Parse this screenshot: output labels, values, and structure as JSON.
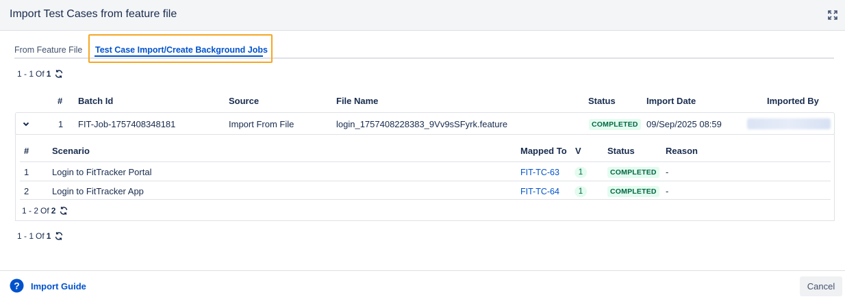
{
  "dialog": {
    "title": "Import Test Cases from feature file"
  },
  "tabs": [
    {
      "label": "From Feature File",
      "active": false
    },
    {
      "label": "Test Case Import/Create Background Jobs",
      "active": true
    }
  ],
  "top_pager": {
    "range": "1 - 1",
    "of_label": "Of",
    "total": "1"
  },
  "jobs_table": {
    "columns": [
      "#",
      "Batch Id",
      "Source",
      "File Name",
      "Status",
      "Import Date",
      "Imported By"
    ],
    "rows": [
      {
        "num": "1",
        "batch_id": "FIT-Job-1757408348181",
        "source": "Import From File",
        "file_name": "login_1757408228383_9Vv9sSFyrk.feature",
        "status": "COMPLETED",
        "import_date": "09/Sep/2025 08:59",
        "imported_by": ""
      }
    ]
  },
  "scenarios_table": {
    "columns": [
      "#",
      "Scenario",
      "Mapped To",
      "V",
      "Status",
      "Reason"
    ],
    "rows": [
      {
        "num": "1",
        "scenario": "Login to FitTracker Portal",
        "mapped_to": "FIT-TC-63",
        "version": "1",
        "status": "COMPLETED",
        "reason": "-"
      },
      {
        "num": "2",
        "scenario": "Login to FitTracker App",
        "mapped_to": "FIT-TC-64",
        "version": "1",
        "status": "COMPLETED",
        "reason": "-"
      }
    ],
    "pager": {
      "range": "1 - 2",
      "of_label": "Of",
      "total": "2"
    }
  },
  "bottom_pager": {
    "range": "1 - 1",
    "of_label": "Of",
    "total": "1"
  },
  "footer": {
    "guide_label": "Import Guide",
    "cancel_label": "Cancel"
  },
  "colors": {
    "accent": "#0052cc",
    "highlight": "#f5a623",
    "status_bg": "#e3fcef",
    "status_text": "#006644"
  },
  "icons": [
    "expand-icon",
    "refresh-icon",
    "chevron-down-icon",
    "help-icon"
  ]
}
